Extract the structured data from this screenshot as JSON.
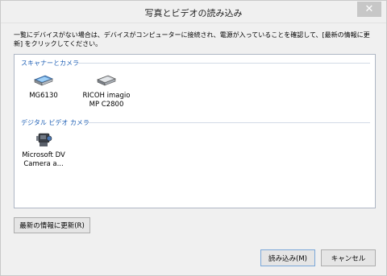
{
  "window": {
    "title": "写真とビデオの読み込み",
    "close_glyph": "✕"
  },
  "instructions": "一覧にデバイスがない場合は、デバイスがコンピューターに接続され、電源が入っていることを確認して、[最新の情報に更新] をクリックしてください。",
  "groups": [
    {
      "label": "スキャナーとカメラ",
      "devices": [
        {
          "label_line1": "MG6130",
          "label_line2": "",
          "icon": "scanner-icon"
        },
        {
          "label_line1": "RICOH imagio",
          "label_line2": "MP C2800",
          "icon": "scanner-icon"
        }
      ]
    },
    {
      "label": "デジタル ビデオ カメラ",
      "devices": [
        {
          "label_line1": "Microsoft DV",
          "label_line2": "Camera a...",
          "icon": "video-camera-icon"
        }
      ]
    }
  ],
  "buttons": {
    "refresh": "最新の情報に更新(R)",
    "import": "読み込み(M)",
    "cancel": "キャンセル"
  },
  "colors": {
    "group_header": "#1e5fb5",
    "selection": "#cce8ff"
  }
}
